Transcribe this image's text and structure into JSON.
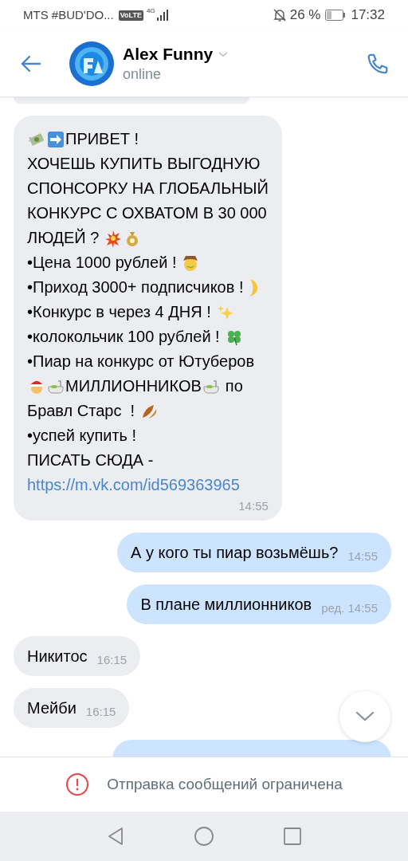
{
  "status_bar": {
    "carrier": "MTS #BUD'DO...",
    "volte": "VoLTE",
    "network": "4G",
    "battery": "26 %",
    "time": "17:32"
  },
  "header": {
    "name": "Alex Funny",
    "status": "online"
  },
  "messages": [
    {
      "outgoing": false,
      "lines": [
        {
          "parts": [
            "ПРИВЕТ !"
          ]
        },
        {
          "parts": [
            "ХОЧЕШЬ КУПИТЬ ВЫГОДНУЮ"
          ]
        },
        {
          "parts": [
            "СПОНСОРКУ НА ГЛОБАЛЬНЫЙ"
          ]
        },
        {
          "parts": [
            "КОНКУРС С ОХВАТОМ В 30 000"
          ]
        },
        {
          "parts": [
            "ЛЮДЕЙ ?"
          ]
        },
        {
          "parts": [
            "•Цена 1000 рублей !"
          ]
        },
        {
          "parts": [
            "•Приход 3000+ подписчиков !"
          ]
        },
        {
          "parts": [
            "•Конкурс в через 4 ДНЯ !"
          ]
        },
        {
          "parts": [
            "•колокольчик 100 рублей !"
          ]
        },
        {
          "parts": [
            "•Пиар на конкурс от Ютуберов"
          ]
        },
        {
          "parts": [
            "МИЛЛИОННИКОВ",
            "по"
          ]
        },
        {
          "parts": [
            "Бравл Старс  !"
          ]
        },
        {
          "parts": [
            "•успей купить !"
          ]
        },
        {
          "parts": [
            "ПИСАТЬ СЮДА -"
          ]
        }
      ],
      "link": "https://m.vk.com/id569363965",
      "time": "14:55"
    },
    {
      "outgoing": true,
      "text": "А у кого ты пиар возьмёшь?",
      "time": "14:55"
    },
    {
      "outgoing": true,
      "text": "В плане миллионников",
      "edit_mark": "ред.",
      "time": "14:55"
    },
    {
      "outgoing": false,
      "text": "Никитос",
      "time": "16:15"
    },
    {
      "outgoing": false,
      "text": "Мейби",
      "time": "16:15"
    }
  ],
  "notice": "Отправка сообщений ограничена"
}
